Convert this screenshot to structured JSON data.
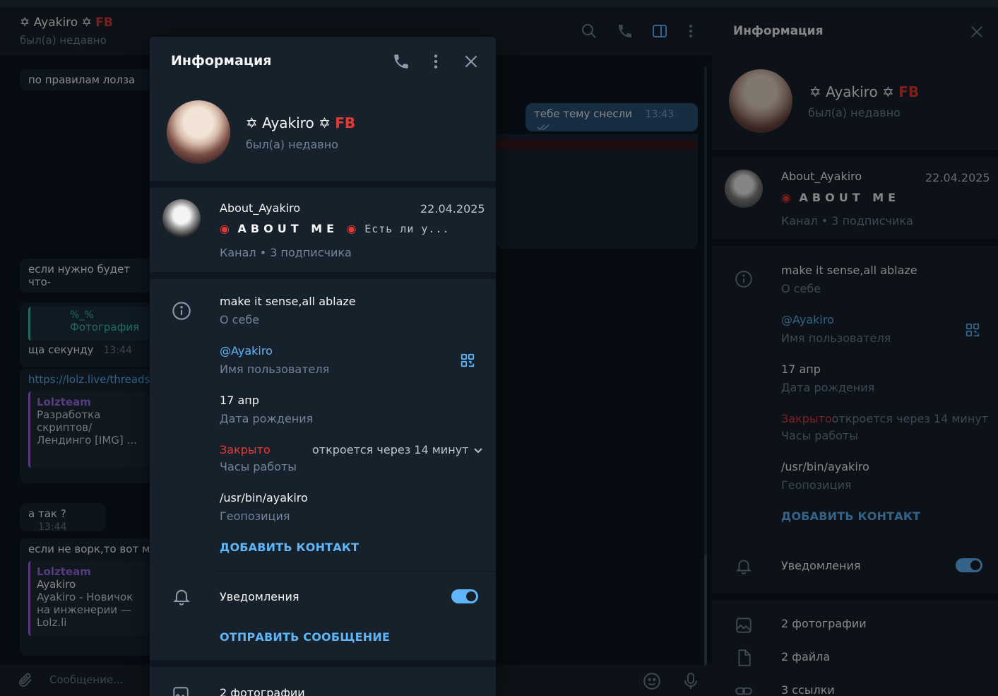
{
  "contact": {
    "name": "Ayakiro",
    "fb": "FB",
    "star": "✡",
    "status": "был(а) недавно"
  },
  "modal": {
    "title": "Информация"
  },
  "channel": {
    "name": "About_Ayakiro",
    "date": "22.04.2025",
    "about_me": "ABOUT ME",
    "preview_rest": "Есть ли у...",
    "meta": "Канал • 3 подписчика"
  },
  "info": {
    "bio": "make it sense,all ablaze",
    "bio_label": "О себе",
    "username": "@Ayakiro",
    "username_label": "Имя пользователя",
    "birthday": "17 апр",
    "birthday_label": "Дата рождения",
    "hours_status": "Закрыто",
    "hours_note": "откроется через 14 минут",
    "hours_label": "Часы работы",
    "location": "/usr/bin/ayakiro",
    "location_label": "Геопозиция",
    "add_contact": "ДОБАВИТЬ КОНТАКТ"
  },
  "notifications": {
    "label": "Уведомления",
    "enabled": true
  },
  "send_message": "ОТПРАВИТЬ СООБЩЕНИЕ",
  "media": {
    "photos": "2 фотографии",
    "files": "2 файла",
    "links": "3 ссылки"
  },
  "chat": {
    "composer_placeholder": "Сообщение...",
    "messages": [
      {
        "text": "по правилам лолза"
      },
      {
        "text": "тебе тему снесли",
        "time": "13:43"
      },
      {
        "text": "если нужно будет что-"
      },
      {
        "reply_title": "%_%",
        "reply_sub": "Фотография",
        "text": "ща секунду",
        "time": "13:44"
      },
      {
        "link": "https://lolz.live/threads",
        "quote_title": "Lolzteam",
        "quote_text": "Разработка скриптов/Лендинго [IMG] ..."
      },
      {
        "text": "а так ?",
        "time": "13:44"
      },
      {
        "text": "если не ворк,то вот мо",
        "quote_title": "Lolzteam",
        "quote_name": "Ayakiro",
        "quote_text": "Ayakiro - Новичок на инженерии — Lolz.li"
      }
    ]
  },
  "colors": {
    "bg": "#0e1621",
    "panel": "#17212b",
    "accent": "#5eb5f7",
    "danger": "#e53935",
    "muted": "#708499"
  }
}
